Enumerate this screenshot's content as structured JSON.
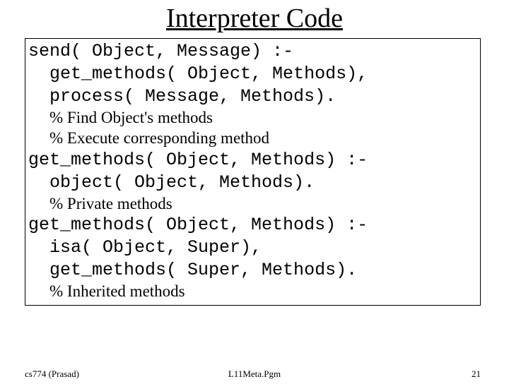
{
  "title": "Interpreter Code",
  "block1": {
    "l1": "send( Object, Message) :-",
    "l2": "  get_methods( Object, Methods),",
    "l3": "  process( Message, Methods)."
  },
  "comment1": {
    "l1": "% Find Object's methods",
    "l2": "% Execute corresponding method"
  },
  "block2": {
    "l1": "get_methods( Object, Methods) :-",
    "l2": "  object( Object, Methods)."
  },
  "comment2": {
    "l1": "% Private methods"
  },
  "block3": {
    "l1": "get_methods( Object, Methods) :-",
    "l2": "  isa( Object, Super),",
    "l3": "  get_methods( Super, Methods)."
  },
  "comment3": {
    "l1": "% Inherited methods"
  },
  "footer": {
    "left": "cs774 (Prasad)",
    "center": "L11Meta.Pgm",
    "right": "21"
  }
}
